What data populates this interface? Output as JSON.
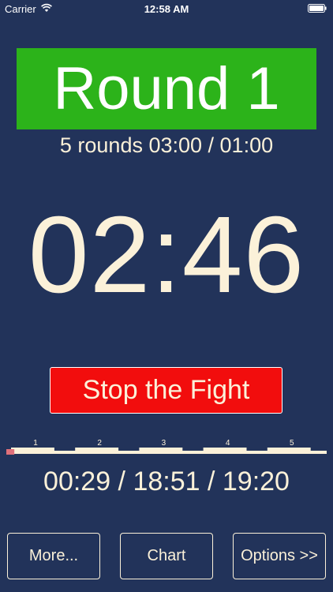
{
  "status_bar": {
    "carrier": "Carrier",
    "time": "12:58 AM",
    "icons": [
      "wifi-icon",
      "battery-icon"
    ]
  },
  "round": {
    "title": "Round 1",
    "info": "5 rounds 03:00 / 01:00",
    "banner_color": "#2cb31a"
  },
  "timer": {
    "display": "02:46"
  },
  "stop_button": {
    "label": "Stop the Fight",
    "color": "#f20d0d"
  },
  "progress": {
    "round_labels": [
      "1",
      "2",
      "3",
      "4",
      "5"
    ],
    "elapsed_fraction": 0.025
  },
  "totals": {
    "text": "00:29 / 18:51 / 19:20"
  },
  "buttons": {
    "more": "More...",
    "chart": "Chart",
    "options": "Options >>"
  },
  "colors": {
    "background": "#22335a",
    "text": "#fbf1d9"
  }
}
